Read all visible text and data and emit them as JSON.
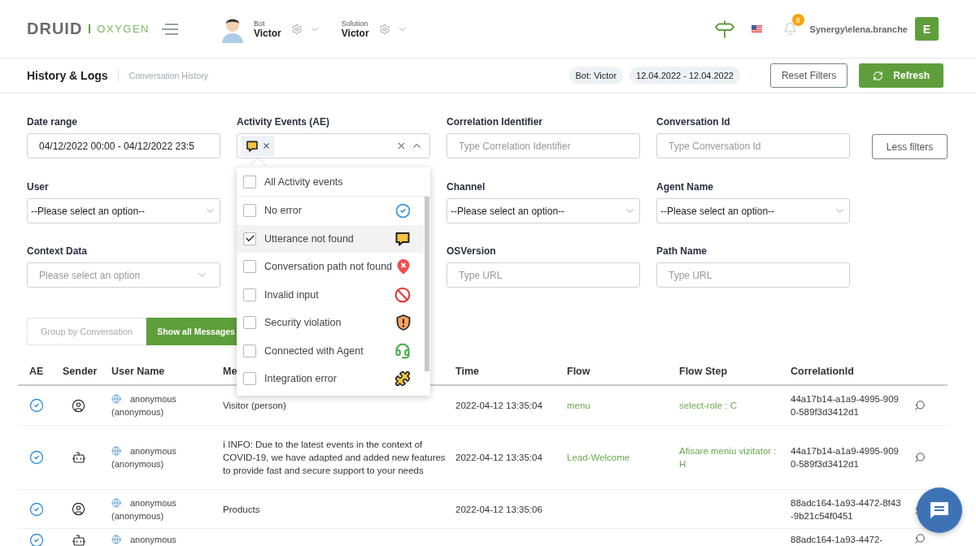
{
  "header": {
    "logo": {
      "brand": "DRUID",
      "product": "OXYGEN"
    },
    "bot": {
      "label": "Bot",
      "name": "Victor"
    },
    "solution": {
      "label": "Solution",
      "name": "Victor"
    },
    "notifications": {
      "count": "8"
    },
    "user": {
      "name": "Synergy\\elena.branche",
      "initial": "E"
    }
  },
  "page": {
    "title": "History & Logs",
    "breadcrumb": "Conversation History",
    "chips": [
      "Bot: Victor",
      "12.04.2022 - 12.04.2022"
    ],
    "reset_button": "Reset Filters",
    "refresh_button": "Refresh"
  },
  "filters": {
    "less_button": "Less filters",
    "rows": [
      [
        {
          "label": "Date range",
          "kind": "value",
          "value": "04/12/2022 00:00 - 04/12/2022 23:5"
        },
        {
          "label": "Activity Events (AE)",
          "kind": "tags",
          "expanded": true,
          "tags": [
            {
              "kind": "bubble"
            }
          ],
          "options": [
            {
              "label": "All Activity events",
              "kind": "none",
              "checked": false,
              "hovered": false
            },
            {
              "label": "No error",
              "kind": "check",
              "checked": false,
              "hovered": false
            },
            {
              "label": "Utterance not found",
              "kind": "bubble",
              "checked": true,
              "hovered": true
            },
            {
              "label": "Conversation path not found",
              "kind": "pin",
              "checked": false,
              "hovered": false
            },
            {
              "label": "Invalid input",
              "kind": "ban",
              "checked": false,
              "hovered": false
            },
            {
              "label": "Security violation",
              "kind": "shield",
              "checked": false,
              "hovered": false
            },
            {
              "label": "Connected with Agent",
              "kind": "headset",
              "checked": false,
              "hovered": false
            },
            {
              "label": "Integration error",
              "kind": "puzzle",
              "checked": false,
              "hovered": false
            }
          ]
        },
        {
          "label": "Correlation Identifier",
          "kind": "text",
          "placeholder": "Type Correlation Identifier"
        },
        {
          "label": "Conversation Id",
          "kind": "text",
          "placeholder": "Type Conversation Id"
        }
      ],
      [
        {
          "label": "User",
          "kind": "select",
          "value": "--Please select an option--"
        },
        null,
        {
          "label": "Channel",
          "kind": "select",
          "value": "--Please select an option--"
        },
        {
          "label": "Agent Name",
          "kind": "select",
          "value": "--Please select an option--"
        }
      ],
      [
        {
          "label": "Context Data",
          "kind": "select",
          "placeholder": "Please select an option"
        },
        null,
        {
          "label": "OSVersion",
          "kind": "text",
          "placeholder": "Type URL"
        },
        {
          "label": "Path Name",
          "kind": "text",
          "placeholder": "Type URL"
        }
      ]
    ]
  },
  "view_toggle": [
    {
      "label": "Group by Conversation",
      "selected": false
    },
    {
      "label": "Show all Messages",
      "selected": true
    }
  ],
  "table": {
    "columns": [
      "AE",
      "Sender",
      "User Name",
      "Me",
      "Time",
      "Flow",
      "Flow Step",
      "CorrelationId"
    ],
    "rows": [
      {
        "ae": {
          "kind": "ok"
        },
        "sender": {
          "kind": "person"
        },
        "user": "anonymous",
        "user_detail": "(anonymous)",
        "message": "Visitor (person)",
        "time": "2022-04-12 13:35:04",
        "flow": "menu",
        "flow_step": "select-role : C",
        "correlation_id": "44a17b14-a1a9-4995-9090-589f3d3412d1"
      },
      {
        "ae": {
          "kind": "ok"
        },
        "sender": {
          "kind": "bot"
        },
        "user": "anonymous",
        "user_detail": "(anonymous)",
        "message": "ℹ INFO: Due to the latest events in the context of COVID-19, we have adapted and added new features to provide fast and secure support to your needs",
        "time": "2022-04-12 13:35:04",
        "flow": "Lead-Welcome",
        "flow_step": "Afisare meniu vizitator : H",
        "correlation_id": "44a17b14-a1a9-4995-9090-589f3d3412d1"
      },
      {
        "ae": {
          "kind": "ok"
        },
        "sender": {
          "kind": "person"
        },
        "user": "anonymous",
        "user_detail": "(anonymous)",
        "message": "Products",
        "time": "2022-04-12 13:35:06",
        "correlation_id": "88adc164-1a93-4472-8f43-9b21c54f0451"
      },
      {
        "ae": {
          "kind": "ok"
        },
        "sender": {
          "kind": "bot"
        },
        "user": "anonymous",
        "correlation_id": "88adc164-1a93-4472-"
      }
    ]
  }
}
